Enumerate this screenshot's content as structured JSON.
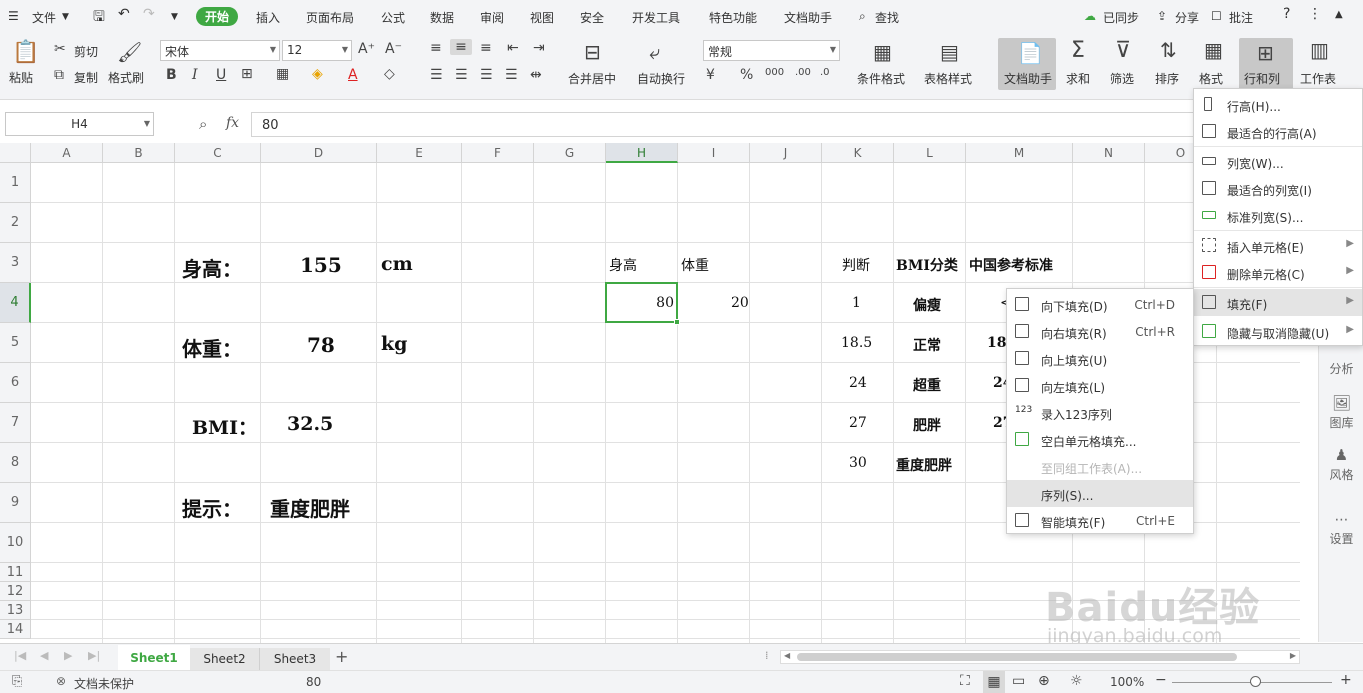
{
  "titlebar": {
    "file_menu": "文件",
    "tabs": [
      "开始",
      "插入",
      "页面布局",
      "公式",
      "数据",
      "审阅",
      "视图",
      "安全",
      "开发工具",
      "特色功能",
      "文档助手"
    ],
    "search": "查找",
    "synced": "已同步",
    "share": "分享",
    "comment": "批注"
  },
  "ribbon": {
    "paste": "粘贴",
    "cut": "剪切",
    "copy": "复制",
    "format_painter": "格式刷",
    "font_name": "宋体",
    "font_size": "12",
    "merge_center": "合并居中",
    "wrap_text": "自动换行",
    "number_format": "常规",
    "conditional_format": "条件格式",
    "table_style": "表格样式",
    "doc_assistant": "文档助手",
    "sum": "求和",
    "filter": "筛选",
    "sort": "排序",
    "format": "格式",
    "row_col": "行和列",
    "worksheet": "工作表",
    "bold": "B",
    "italic": "I",
    "underline": "U",
    "font_color_letter": "A",
    "percent": "%",
    "thousands": "000",
    "inc_decimal": ".00",
    "currency": "¥"
  },
  "formula_bar": {
    "name_box": "H4",
    "fx": "fx",
    "value": "80"
  },
  "columns": [
    "A",
    "B",
    "C",
    "D",
    "E",
    "F",
    "G",
    "H",
    "I",
    "J",
    "K",
    "L",
    "M",
    "N",
    "O"
  ],
  "rows": [
    "1",
    "2",
    "3",
    "4",
    "5",
    "6",
    "7",
    "8",
    "9",
    "10",
    "11",
    "12",
    "13",
    "14"
  ],
  "cells": {
    "c3": "身高：",
    "d3": "155",
    "e3": "cm",
    "c5": "体重：",
    "d5": "78",
    "e5": "kg",
    "c7": "BMI：",
    "d7": "32.5",
    "c9": "提示：",
    "d9": "重度肥胖",
    "h3": "身高",
    "i3": "体重",
    "h4": "80",
    "i4": "20",
    "k3": "判断",
    "l3": "BMI分类",
    "m3": "中国参考标准",
    "k4": "1",
    "l4": "偏瘦",
    "m4": "<",
    "k5": "18.5",
    "l5": "正常",
    "m5": "18.",
    "k6": "24",
    "l6": "超重",
    "m6": "24",
    "k7": "27",
    "l7": "肥胖",
    "m7": "27",
    "k8": "30",
    "l8": "重度肥胖"
  },
  "rowcol_menu": [
    {
      "label": "行高(H)..."
    },
    {
      "label": "最适合的行高(A)"
    },
    {
      "label": "列宽(W)..."
    },
    {
      "label": "最适合的列宽(I)"
    },
    {
      "label": "标准列宽(S)..."
    },
    {
      "label": "插入单元格(E)"
    },
    {
      "label": "删除单元格(C)"
    },
    {
      "label": "填充(F)"
    },
    {
      "label": "隐藏与取消隐藏(U)"
    }
  ],
  "fill_menu": [
    {
      "label": "向下填充(D)",
      "shortcut": "Ctrl+D"
    },
    {
      "label": "向右填充(R)",
      "shortcut": "Ctrl+R"
    },
    {
      "label": "向上填充(U)",
      "shortcut": ""
    },
    {
      "label": "向左填充(L)",
      "shortcut": ""
    },
    {
      "label": "录入123序列",
      "shortcut": ""
    },
    {
      "label": "空白单元格填充...",
      "shortcut": ""
    },
    {
      "label": "至同组工作表(A)...",
      "shortcut": ""
    },
    {
      "label": "序列(S)...",
      "shortcut": ""
    },
    {
      "label": "智能填充(F)",
      "shortcut": "Ctrl+E"
    }
  ],
  "right_panel": [
    "分析",
    "图库",
    "风格",
    "设置"
  ],
  "sheets": [
    "Sheet1",
    "Sheet2",
    "Sheet3"
  ],
  "status": {
    "protect": "文档未保护",
    "value": "80",
    "zoom": "100%"
  },
  "watermark": {
    "line1": "Baidu经验",
    "line2": "jingyan.baidu.com"
  }
}
